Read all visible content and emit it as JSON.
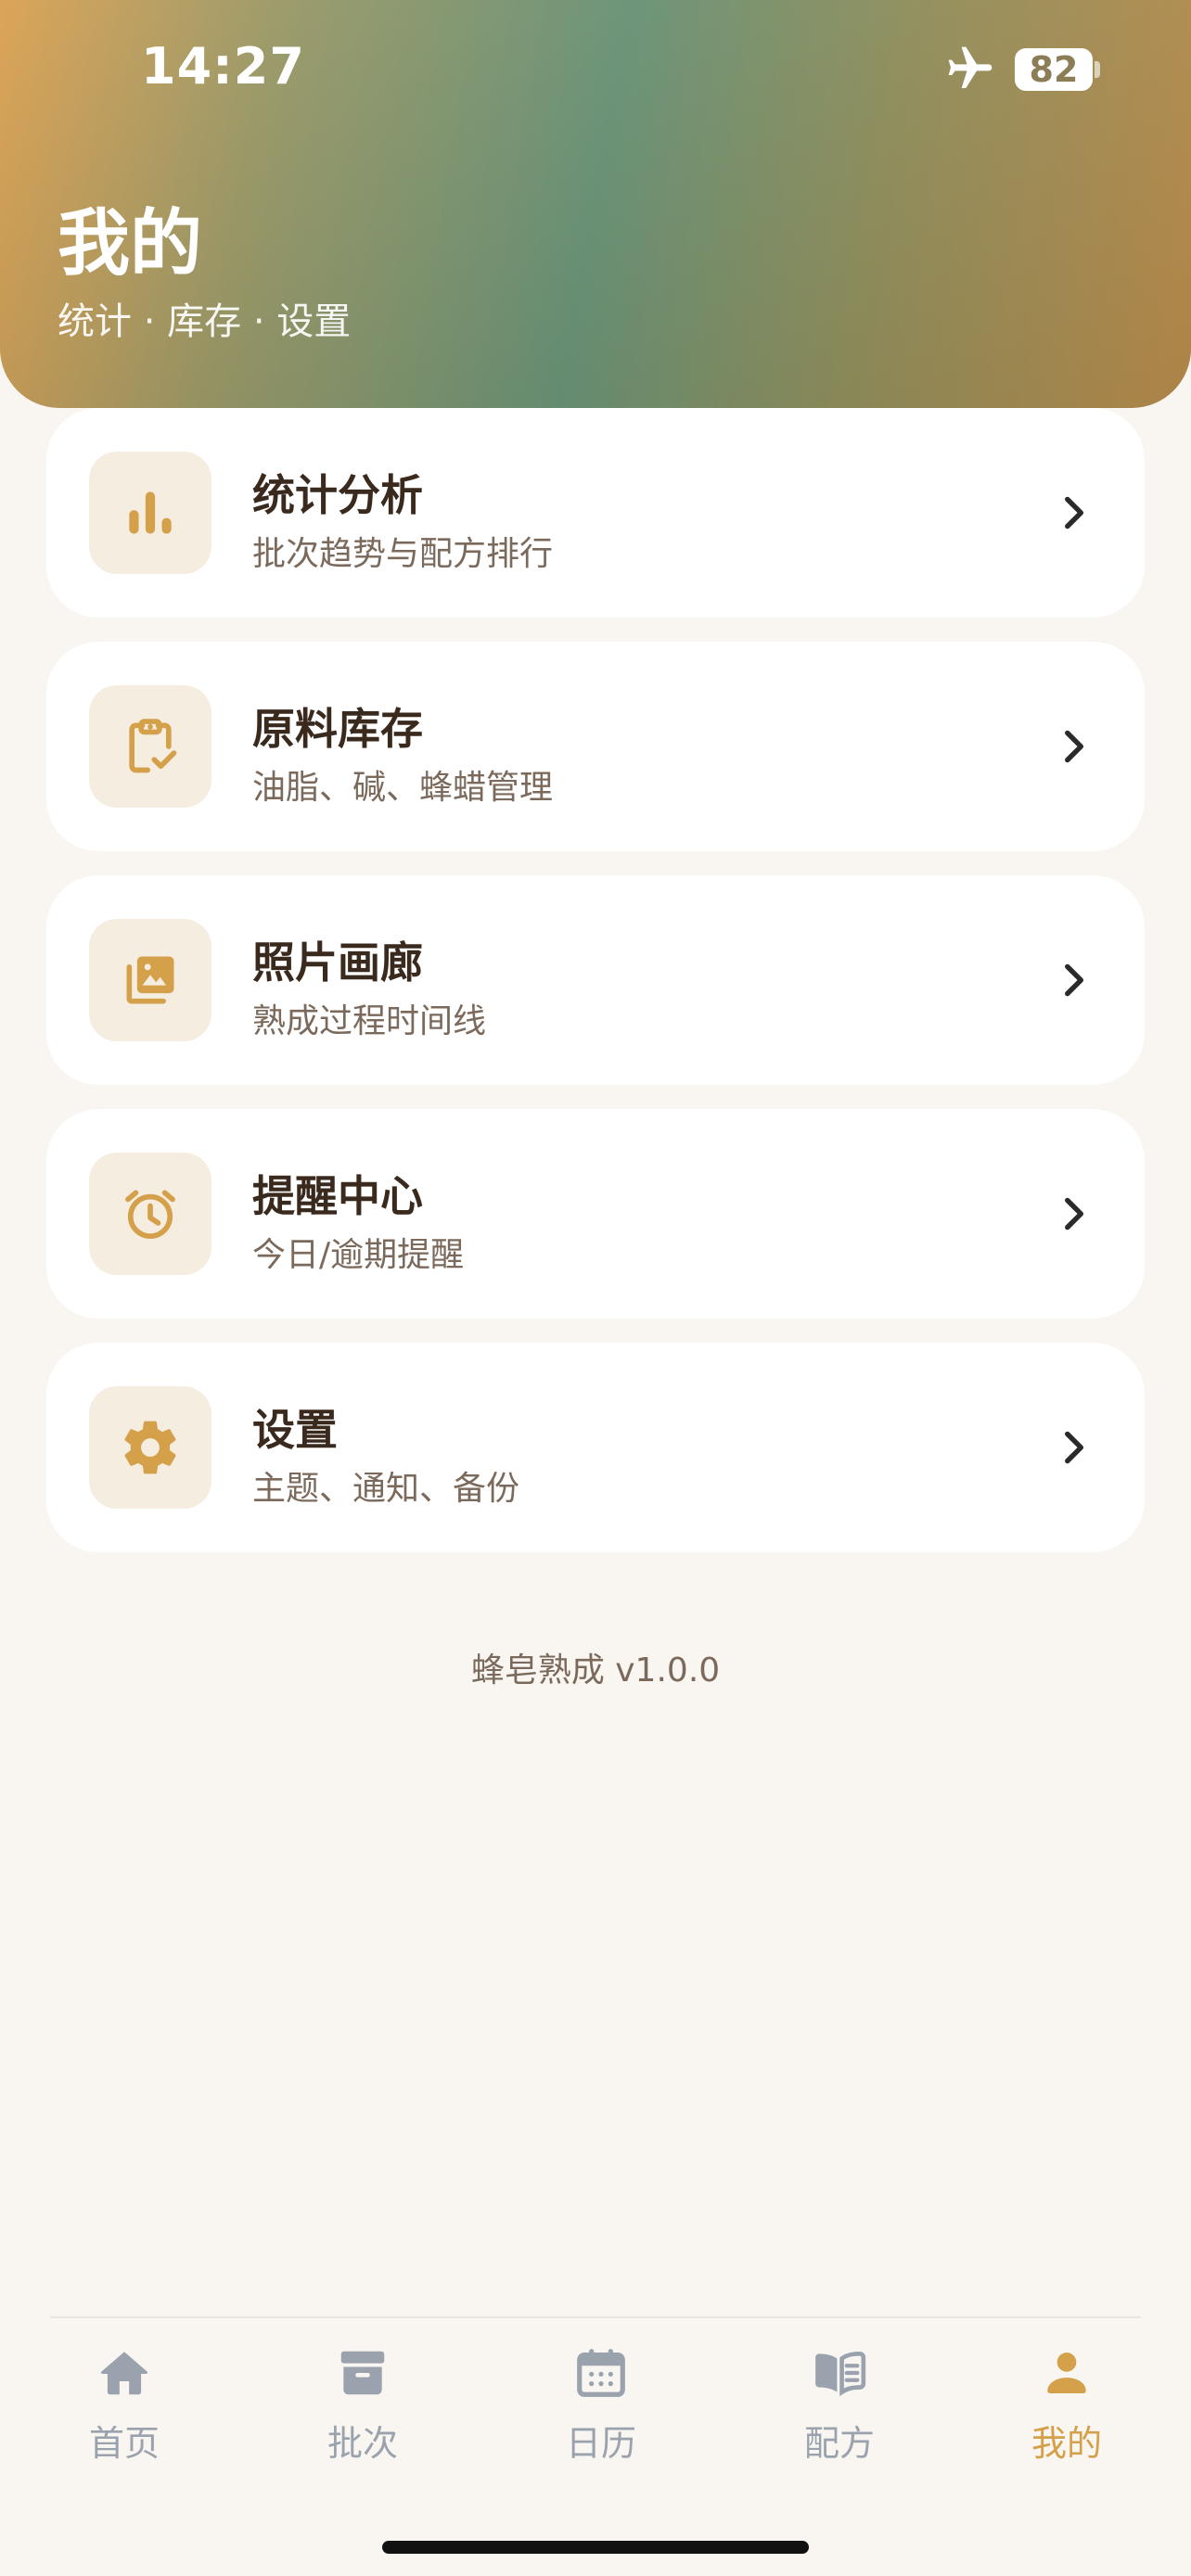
{
  "status_bar": {
    "time": "14:27",
    "battery": "82",
    "airplane_icon": "airplane-icon"
  },
  "header": {
    "title": "我的",
    "subtitle": "统计 · 库存 · 设置"
  },
  "menu": [
    {
      "title": "统计分析",
      "desc": "批次趋势与配方排行",
      "icon": "bar-chart-icon"
    },
    {
      "title": "原料库存",
      "desc": "油脂、碱、蜂蜡管理",
      "icon": "clipboard-check-icon"
    },
    {
      "title": "照片画廊",
      "desc": "熟成过程时间线",
      "icon": "photo-gallery-icon"
    },
    {
      "title": "提醒中心",
      "desc": "今日/逾期提醒",
      "icon": "alarm-clock-icon"
    },
    {
      "title": "设置",
      "desc": "主题、通知、备份",
      "icon": "gear-icon"
    }
  ],
  "version": "蜂皂熟成 v1.0.0",
  "tabbar": [
    {
      "label": "首页",
      "icon": "home-icon",
      "active": false
    },
    {
      "label": "批次",
      "icon": "archive-box-icon",
      "active": false
    },
    {
      "label": "日历",
      "icon": "calendar-icon",
      "active": false
    },
    {
      "label": "配方",
      "icon": "book-icon",
      "active": false
    },
    {
      "label": "我的",
      "icon": "person-icon",
      "active": true
    }
  ],
  "colors": {
    "accent": "#d4a04a",
    "icon_bg": "#f6ede1",
    "inactive_tab": "#9aa2ad",
    "title_text": "#3a2a1e",
    "desc_text": "#7b6a5c",
    "background": "#f9f6f2"
  }
}
